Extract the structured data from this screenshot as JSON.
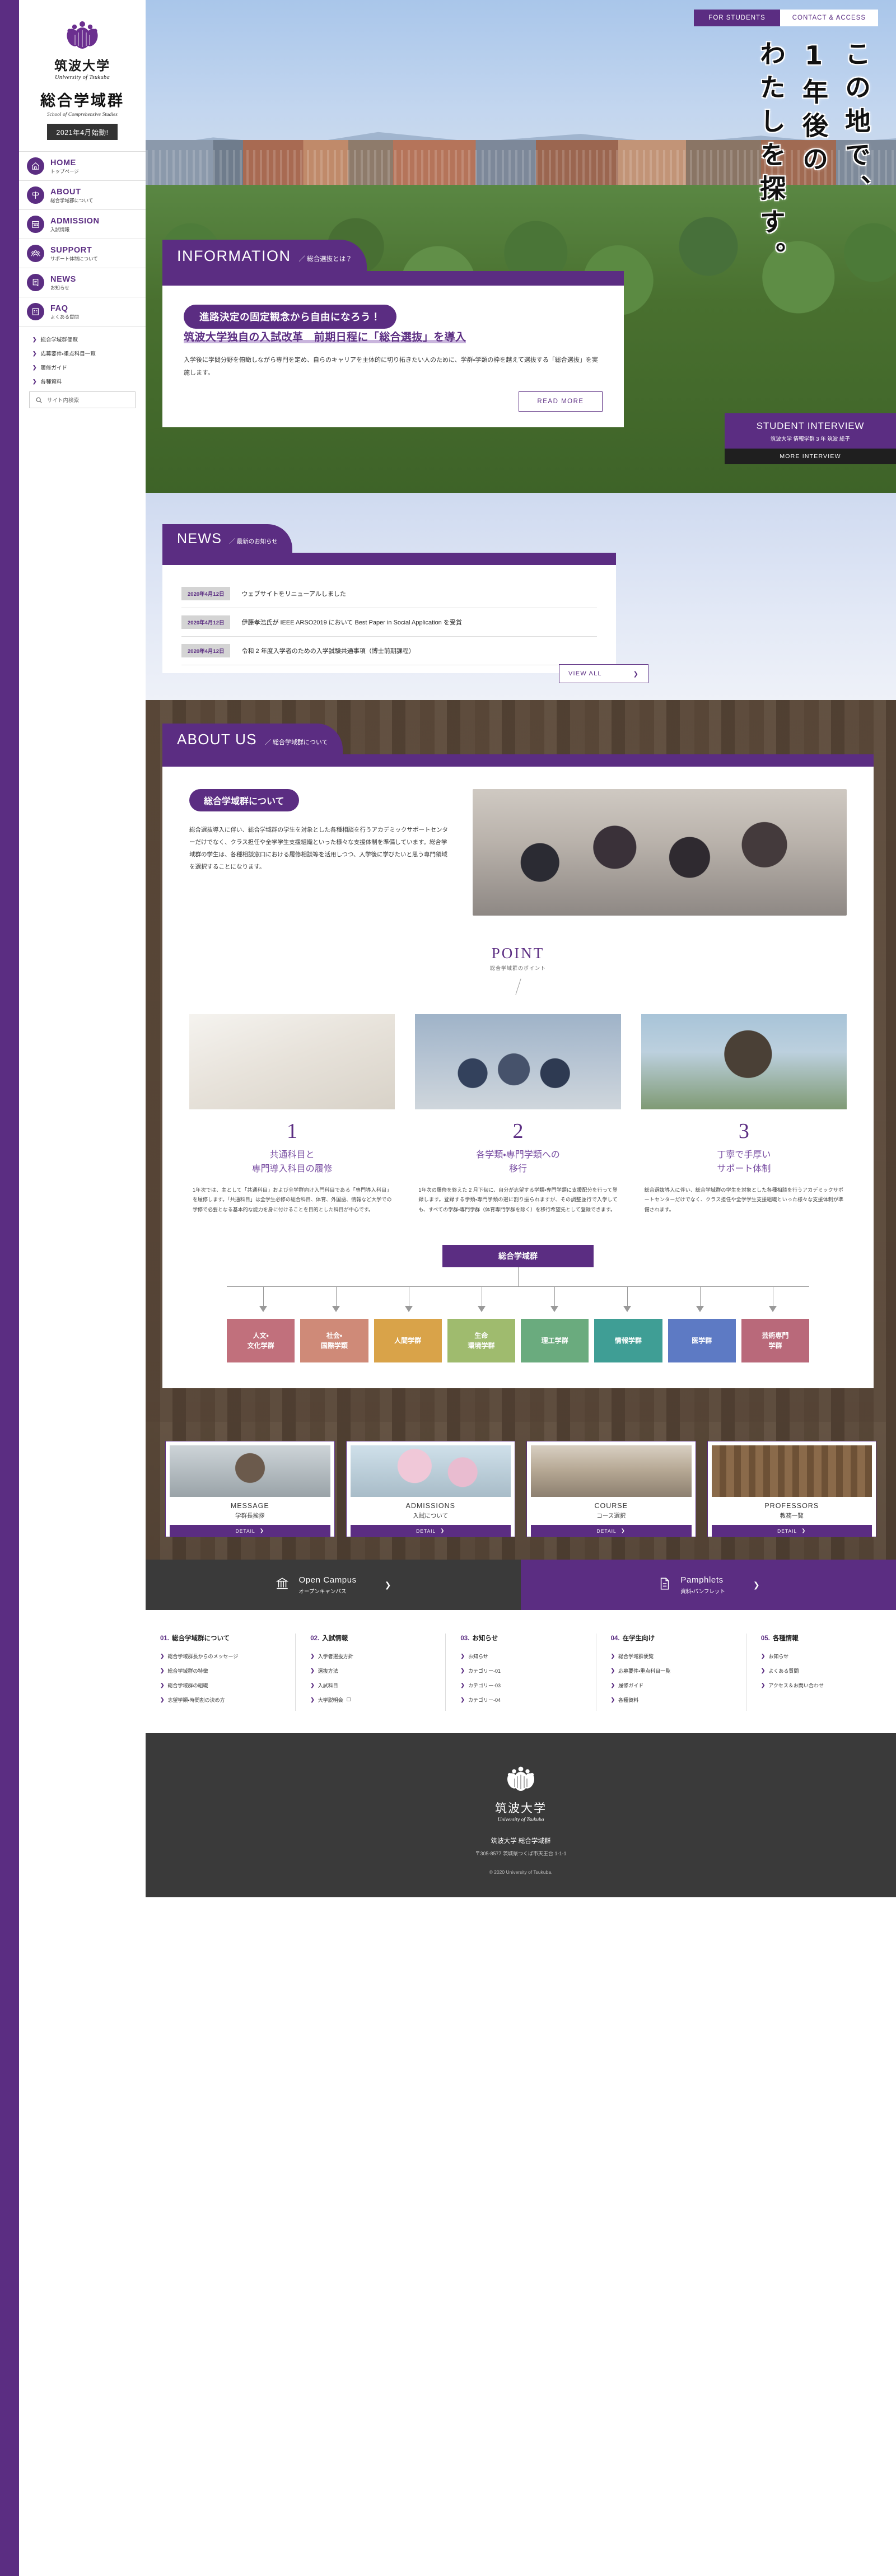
{
  "brand": {
    "logo_jp": "筑波大学",
    "logo_en": "University of Tsukuba",
    "dept_jp": "総合学域群",
    "dept_en": "School of Comprehensive Studies",
    "badge": "2021年4月始動!",
    "accent": "#5b2d82"
  },
  "sidebar": {
    "items": [
      {
        "en": "HOME",
        "jp": "トップページ",
        "icon": "home-icon"
      },
      {
        "en": "ABOUT",
        "jp": "総合学域郡について",
        "icon": "signpost-icon"
      },
      {
        "en": "ADMISSION",
        "jp": "入試情報",
        "icon": "calendar-icon"
      },
      {
        "en": "SUPPORT",
        "jp": "サポート体制について",
        "icon": "people-icon"
      },
      {
        "en": "NEWS",
        "jp": "お知らせ",
        "icon": "news-icon"
      },
      {
        "en": "FAQ",
        "jp": "よくある質問",
        "icon": "faq-icon"
      }
    ],
    "sub_links": [
      "総合学域群便覧",
      "応募要件・重点科目一覧",
      "履修ガイド",
      "各種資料"
    ],
    "search_placeholder": "サイト内検索"
  },
  "header": {
    "for_students": "FOR STUDENTS",
    "contact_access": "CONTACT & ACCESS"
  },
  "hero": {
    "vertical_lines": [
      "この地で、",
      "1年後の",
      "わたしを探す。"
    ]
  },
  "information": {
    "head_en": "INFORMATION",
    "head_jp": "／ 総合選抜とは？",
    "pill": "進路決定の固定観念から自由になろう！",
    "title": "筑波大学独自の入試改革　前期日程に「総合選抜」を導入",
    "desc": "入学後に学問分野を俯瞰しながら専門を定め、自らのキャリアを主体的に切り拓きたい人のために、学群・学類の枠を越えて選抜する「総合選抜」を実施します。",
    "read_more": "READ MORE"
  },
  "student_interview": {
    "title": "STUDENT INTERVIEW",
    "subtitle": "筑波大学 情報学群 3 年 筑波 総子",
    "more": "MORE INTERVIEW"
  },
  "news": {
    "head_en": "NEWS",
    "head_jp": "／ 最新のお知らせ",
    "items": [
      {
        "date": "2020年4月12日",
        "text": "ウェブサイトをリニューアルしました"
      },
      {
        "date": "2020年4月12日",
        "text": "伊藤孝浩氏が IEEE ARSO2019 において Best Paper in Social Application を受賞"
      },
      {
        "date": "2020年4月12日",
        "text": "令和 2 年度入学者のための入学試験共通事項（博士前期課程）"
      }
    ],
    "view_all": "VIEW ALL"
  },
  "about": {
    "head_en": "ABOUT US",
    "head_jp": "／ 総合学域群について",
    "pill": "総合学域群について",
    "paragraph": "総合選抜導入に伴い、総合学域群の学生を対象とした各種相談を行うアカデミックサポートセンターだけでなく、クラス担任や全学学生支援組織といった様々な支援体制を準備しています。総合学域群の学生は、各種相談窓口における履修相談等を活用しつつ、入学後に学びたいと思う専門領域を選択することになります。",
    "point_en": "POINT",
    "point_jp": "総合学域群のポイント",
    "points": [
      {
        "num": "1",
        "title": "共通科目と\n専門導入科目の履修",
        "body": "1年次では、主として「共通科目」および全学群向け入門科目である「専門導入科目」を履修します。「共通科目」は全学生必修の総合科目、体育、外国語、情報など大学での学修で必要となる基本的な能力を身に付けることを目的とした科目が中心です。"
      },
      {
        "num": "2",
        "title": "各学類・専門学類への\n移行",
        "body": "1年次の履修を終えた 2 月下旬に、自分が志望する学類・専門学類に支援配分を行って登録します。登録する学類・専門学類の選に割り振られますが、その調整並行で入学しても、すべての学群・専門学群（体育専門学群を除く）を移行希望先として登録できます。"
      },
      {
        "num": "3",
        "title": "丁寧で手厚い\nサポート体制",
        "body": "総合選抜導入に伴い、総合学域群の学生を対象とした各種相談を行うアカデミックサポートセンターだけでなく、クラス担任や全学学生支援組織といった様々な支援体制が準備されます。"
      }
    ],
    "diagram_top": "総合学域群",
    "departments": [
      {
        "label": "人文・\n文化学群",
        "color": "#c1707c"
      },
      {
        "label": "社会・\n国際学類",
        "color": "#cf8a78"
      },
      {
        "label": "人間学群",
        "color": "#d9a349"
      },
      {
        "label": "生命\n環境学群",
        "color": "#9fbb6e"
      },
      {
        "label": "理工学群",
        "color": "#6aab7e"
      },
      {
        "label": "情報学群",
        "color": "#3f9e95"
      },
      {
        "label": "医学群",
        "color": "#5d7ac4"
      },
      {
        "label": "芸術専門\n学群",
        "color": "#b9697a"
      }
    ]
  },
  "cards": [
    {
      "en": "MESSAGE",
      "jp": "学群長挨拶",
      "detail": "DETAIL"
    },
    {
      "en": "ADMISSIONS",
      "jp": "入試について",
      "detail": "DETAIL"
    },
    {
      "en": "COURSE",
      "jp": "コース選択",
      "detail": "DETAIL"
    },
    {
      "en": "PROFESSORS",
      "jp": "教務一覧",
      "detail": "DETAIL"
    }
  ],
  "cta": {
    "left": {
      "en": "Open Campus",
      "jp": "オープンキャンパス",
      "icon": "campus-icon"
    },
    "right": {
      "en": "Pamphlets",
      "jp": "資料・パンフレット",
      "icon": "document-icon"
    }
  },
  "footer_links": [
    {
      "num": "01.",
      "heading": "総合学域群について",
      "links": [
        "総合学域群長からのメッセージ",
        "総合学域群の特徴",
        "総合学域群の組織",
        "志望学類・時間割の決め方"
      ]
    },
    {
      "num": "02.",
      "heading": "入試情報",
      "links": [
        "入学者選抜方針",
        "選抜方法",
        "入試科目",
        "大学説明会"
      ]
    },
    {
      "num": "03.",
      "heading": "お知らせ",
      "links": [
        "お知らせ",
        "カテゴリー-01",
        "カテゴリー-03",
        "カテゴリー-04"
      ]
    },
    {
      "num": "04.",
      "heading": "在学生向け",
      "links": [
        "総合学域群便覧",
        "応募要件・重点科目一覧",
        "履修ガイド",
        "各種資料"
      ]
    },
    {
      "num": "05.",
      "heading": "各種情報",
      "links": [
        "お知らせ",
        "よくある質問",
        "アクセス＆お問い合わせ"
      ]
    }
  ],
  "footer": {
    "logo_jp": "筑波大学",
    "logo_en": "University of Tsukuba",
    "name": "筑波大学 総合学域群",
    "address": "〒305-8577 茨城県つくば市天王台 1-1-1",
    "copyright": "© 2020 University of Tsukuba."
  }
}
